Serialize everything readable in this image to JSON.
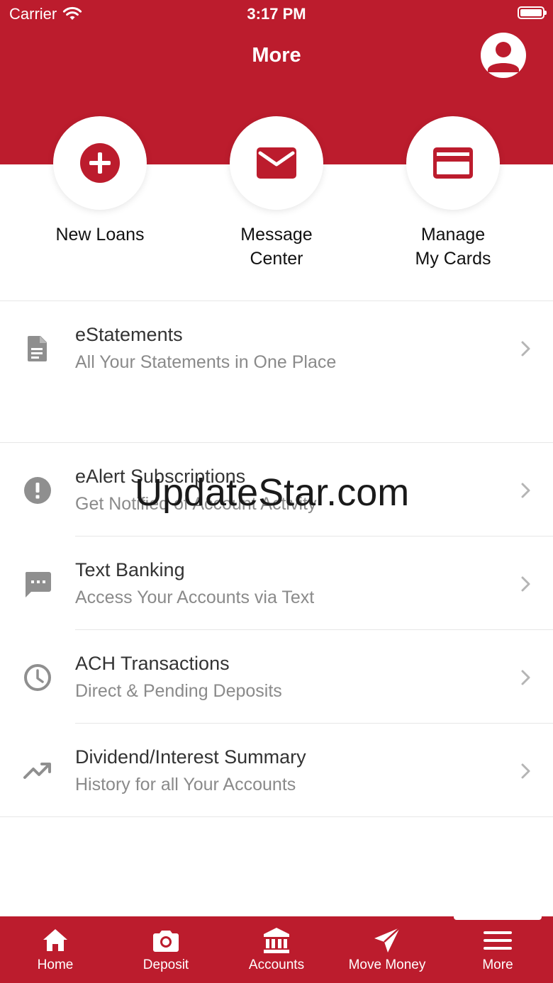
{
  "status_bar": {
    "carrier": "Carrier",
    "time": "3:17 PM"
  },
  "header": {
    "title": "More",
    "profile_icon": "user-avatar-icon"
  },
  "quick_actions": [
    {
      "line1": "New Loans",
      "line2": "",
      "icon": "plus-circle-icon"
    },
    {
      "line1": "Message",
      "line2": "Center",
      "icon": "envelope-icon"
    },
    {
      "line1": "Manage",
      "line2": "My Cards",
      "icon": "credit-card-icon"
    }
  ],
  "menu": [
    {
      "title": "eStatements",
      "subtitle": "All Your Statements in One Place",
      "icon": "document-icon"
    },
    {
      "title": "eAlert Subscriptions",
      "subtitle": "Get Notified of Account Activity",
      "icon": "alert-icon"
    },
    {
      "title": "Text Banking",
      "subtitle": "Access Your Accounts via Text",
      "icon": "chat-icon"
    },
    {
      "title": "ACH Transactions",
      "subtitle": "Direct & Pending Deposits",
      "icon": "clock-icon"
    },
    {
      "title": "Dividend/Interest Summary",
      "subtitle": "History for all Your Accounts",
      "icon": "trending-up-icon"
    }
  ],
  "watermark": "UpdateStar.com",
  "tab_bar": {
    "tabs": [
      {
        "label": "Home",
        "icon": "home-icon"
      },
      {
        "label": "Deposit",
        "icon": "camera-icon"
      },
      {
        "label": "Accounts",
        "icon": "bank-icon"
      },
      {
        "label": "Move Money",
        "icon": "send-icon"
      },
      {
        "label": "More",
        "icon": "menu-icon"
      }
    ],
    "active": "More"
  },
  "colors": {
    "brand_red": "#bc1c2d",
    "icon_gray": "#8f8f8f",
    "text_dark": "#333333",
    "text_muted": "#8a8a8a"
  }
}
